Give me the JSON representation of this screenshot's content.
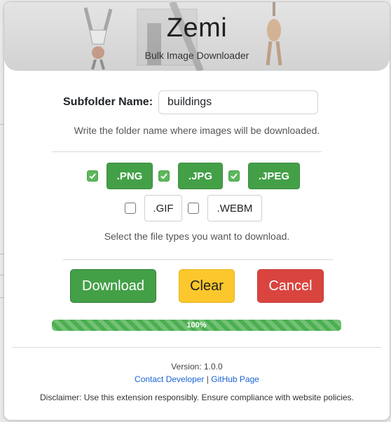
{
  "app": {
    "title": "Zemi",
    "subtitle": "Bulk Image Downloader"
  },
  "subfolder": {
    "label": "Subfolder Name:",
    "value": "buildings",
    "help": "Write the folder name where images will be downloaded."
  },
  "file_types": {
    "items": [
      {
        "label": ".PNG",
        "checked": true
      },
      {
        "label": ".JPG",
        "checked": true
      },
      {
        "label": ".JPEG",
        "checked": true
      },
      {
        "label": ".GIF",
        "checked": false
      },
      {
        "label": ".WEBM",
        "checked": false
      }
    ],
    "help": "Select the file types you want to download."
  },
  "actions": {
    "download_label": "Download",
    "clear_label": "Clear",
    "cancel_label": "Cancel"
  },
  "progress": {
    "value_percent": 100,
    "label": "100%"
  },
  "footer": {
    "version": "Version: 1.0.0",
    "contact_link": "Contact Developer",
    "separator": "|",
    "github_link": "GitHub Page",
    "disclaimer": "Disclaimer: Use this extension responsibly. Ensure compliance with website policies."
  },
  "colors": {
    "accent_green": "#43a047",
    "clear_yellow": "#fbc72c",
    "cancel_red": "#d9443f",
    "link_blue": "#1a64d6"
  }
}
